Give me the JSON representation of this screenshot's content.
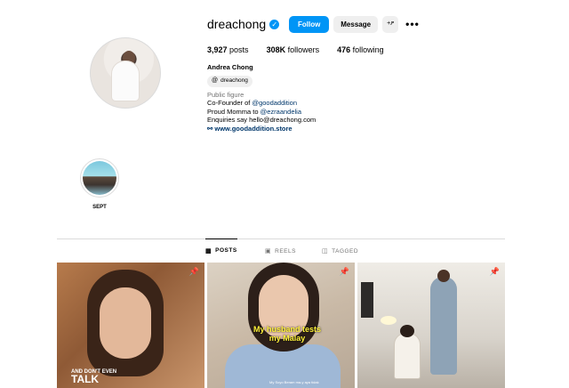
{
  "profile": {
    "username": "dreachong",
    "follow_label": "Follow",
    "message_label": "Message",
    "add_user_icon": "+ዖ",
    "more_icon": "•••",
    "verified_icon": "✓",
    "stats": {
      "posts_count": "3,927",
      "posts_label": "posts",
      "followers_count": "308K",
      "followers_label": "followers",
      "following_count": "476",
      "following_label": "following"
    },
    "full_name": "Andrea Chong",
    "threads_handle": "dreachong",
    "threads_icon": "@",
    "category": "Public figure",
    "bio_line1_prefix": "Co-Founder of ",
    "bio_line1_mention": "@goodaddition",
    "bio_line2_prefix": "Proud Momma to ",
    "bio_line2_mention": "@ezraandelia",
    "bio_line3": "Enquiries say hello@dreachong.com",
    "link_icon": "⚯",
    "link": "www.goodaddition.store"
  },
  "highlights": [
    {
      "label": "SEPT"
    }
  ],
  "tabs": [
    {
      "label": "POSTS",
      "icon": "▦",
      "active": true
    },
    {
      "label": "REELS",
      "icon": "▣",
      "active": false
    },
    {
      "label": "TAGGED",
      "icon": "◫",
      "active": false
    }
  ],
  "posts": [
    {
      "caption_small": "AND DON'T EVEN",
      "caption_big": "TALK",
      "pinned": true
    },
    {
      "caption": "My husband tests my Malay",
      "subtitle": "My Soyo Beram ma-y aya tidak",
      "pinned": true
    },
    {
      "pinned": true
    }
  ],
  "colors": {
    "accent": "#0095f6",
    "link": "#00376b",
    "muted": "#737373",
    "border": "#dbdbdb"
  }
}
